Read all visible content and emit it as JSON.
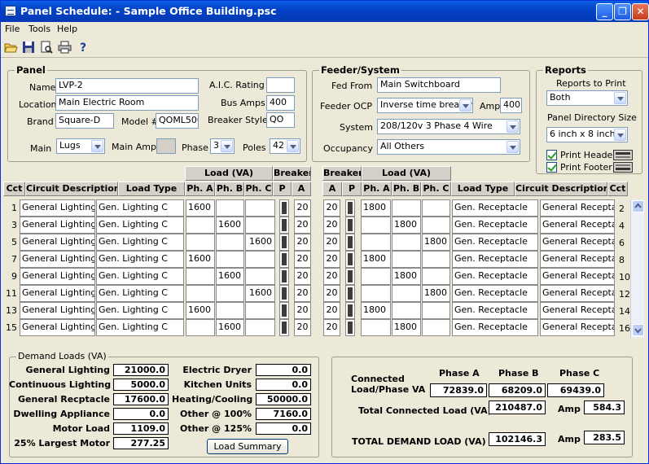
{
  "window": {
    "title": "Panel Schedule: - Sample Office Building.psc",
    "min": "_",
    "max": "❐",
    "close": "✕"
  },
  "menu": [
    "File",
    "Tools",
    "Help"
  ],
  "panel": {
    "heading": "Panel",
    "name_label": "Name",
    "name": "LVP-2",
    "location_label": "Location",
    "location": "Main Electric Room",
    "brand_label": "Brand",
    "brand": "Square-D",
    "model_label": "Model #",
    "model": "QOML500",
    "aic_label": "A.I.C. Rating",
    "aic": "",
    "busamps_label": "Bus Amps",
    "busamps": "400",
    "breaker_style_label": "Breaker Style",
    "breaker_style": "QO",
    "main_label": "Main",
    "main": "Lugs",
    "mainamps_label": "Main Amps",
    "mainamps": "",
    "phase_label": "Phase",
    "phase": "3",
    "poles_label": "Poles",
    "poles": "42"
  },
  "feeder": {
    "heading": "Feeder/System",
    "fedfrom_label": "Fed From",
    "fedfrom": "Main Switchboard",
    "ocp_label": "Feeder OCP",
    "ocp": "Inverse time breaker",
    "amp_label": "Amp",
    "amp": "400",
    "system_label": "System",
    "system": "208/120v 3 Phase 4 Wire",
    "occupancy_label": "Occupancy",
    "occupancy": "All Others"
  },
  "reports": {
    "heading": "Reports",
    "print_label": "Reports to Print",
    "print": "Both",
    "dirsize_label": "Panel Directory Size",
    "dirsize": "6 inch x 8 inch",
    "header_label": "Print Header",
    "footer_label": "Print Footer"
  },
  "table": {
    "h_load": "Load (VA)",
    "h_breaker": "Breaker",
    "h_cct": "Cct",
    "h_desc": "Circuit Description",
    "h_type": "Load Type",
    "h_pa": "Ph. A",
    "h_pb": "Ph. B",
    "h_pc": "Ph. C",
    "h_p": "P",
    "h_a": "A",
    "left": [
      {
        "cct": "1",
        "desc": "General Lighting",
        "type": "Gen. Lighting C",
        "pa": "1600",
        "pb": "",
        "pc": "",
        "amp": "20"
      },
      {
        "cct": "3",
        "desc": "General Lighting",
        "type": "Gen. Lighting C",
        "pa": "",
        "pb": "1600",
        "pc": "",
        "amp": "20"
      },
      {
        "cct": "5",
        "desc": "General Lighting",
        "type": "Gen. Lighting C",
        "pa": "",
        "pb": "",
        "pc": "1600",
        "amp": "20"
      },
      {
        "cct": "7",
        "desc": "General Lighting",
        "type": "Gen. Lighting C",
        "pa": "1600",
        "pb": "",
        "pc": "",
        "amp": "20"
      },
      {
        "cct": "9",
        "desc": "General Lighting",
        "type": "Gen. Lighting C",
        "pa": "",
        "pb": "1600",
        "pc": "",
        "amp": "20"
      },
      {
        "cct": "11",
        "desc": "General Lighting",
        "type": "Gen. Lighting C",
        "pa": "",
        "pb": "",
        "pc": "1600",
        "amp": "20"
      },
      {
        "cct": "13",
        "desc": "General Lighting",
        "type": "Gen. Lighting C",
        "pa": "1600",
        "pb": "",
        "pc": "",
        "amp": "20"
      },
      {
        "cct": "15",
        "desc": "General Lighting",
        "type": "Gen. Lighting C",
        "pa": "",
        "pb": "1600",
        "pc": "",
        "amp": "20"
      }
    ],
    "right": [
      {
        "cct": "2",
        "desc": "General Receptacl",
        "type": "Gen. Receptacle",
        "pa": "1800",
        "pb": "",
        "pc": "",
        "amp": "20"
      },
      {
        "cct": "4",
        "desc": "General Receptacl",
        "type": "Gen. Receptacle",
        "pa": "",
        "pb": "1800",
        "pc": "",
        "amp": "20"
      },
      {
        "cct": "6",
        "desc": "General Receptacl",
        "type": "Gen. Receptacle",
        "pa": "",
        "pb": "",
        "pc": "1800",
        "amp": "20"
      },
      {
        "cct": "8",
        "desc": "General Receptacl",
        "type": "Gen. Receptacle",
        "pa": "1800",
        "pb": "",
        "pc": "",
        "amp": "20"
      },
      {
        "cct": "10",
        "desc": "General Receptacl",
        "type": "Gen. Receptacle",
        "pa": "",
        "pb": "1800",
        "pc": "",
        "amp": "20"
      },
      {
        "cct": "12",
        "desc": "General Receptacl",
        "type": "Gen. Receptacle",
        "pa": "",
        "pb": "",
        "pc": "1800",
        "amp": "20"
      },
      {
        "cct": "14",
        "desc": "General Receptacl",
        "type": "Gen. Receptacle",
        "pa": "1800",
        "pb": "",
        "pc": "",
        "amp": "20"
      },
      {
        "cct": "16",
        "desc": "General Receptacl",
        "type": "Gen. Receptacle",
        "pa": "",
        "pb": "1800",
        "pc": "",
        "amp": "20"
      }
    ]
  },
  "demand": {
    "heading": "Demand Loads (VA)",
    "left": [
      {
        "label": "General Lighting",
        "value": "21000.0"
      },
      {
        "label": "Continuous Lighting",
        "value": "5000.0"
      },
      {
        "label": "General  Recptacle",
        "value": "17600.0"
      },
      {
        "label": "Dwelling Appliance",
        "value": "0.0"
      },
      {
        "label": "Motor Load",
        "value": "1109.0"
      },
      {
        "label": "25% Largest Motor",
        "value": "277.25"
      }
    ],
    "right": [
      {
        "label": "Electric Dryer",
        "value": "0.0"
      },
      {
        "label": "Kitchen Units",
        "value": "0.0"
      },
      {
        "label": "Heating/Cooling",
        "value": "50000.0"
      },
      {
        "label": "Other @ 100%",
        "value": "7160.0"
      },
      {
        "label": "Other @ 125%",
        "value": "0.0"
      }
    ],
    "summary_btn": "Load Summary"
  },
  "totals": {
    "phase_a": "Phase A",
    "phase_b": "Phase B",
    "phase_c": "Phase C",
    "connected_label": "Connected Load/Phase VA",
    "va_a": "72839.0",
    "va_b": "68209.0",
    "va_c": "69439.0",
    "total_label": "Total Connected Load (VA)",
    "total": "210487.0",
    "amp_label": "Amp",
    "total_amp": "584.3",
    "demand_label": "TOTAL DEMAND LOAD (VA)",
    "demand": "102146.3",
    "demand_amp": "283.5"
  }
}
